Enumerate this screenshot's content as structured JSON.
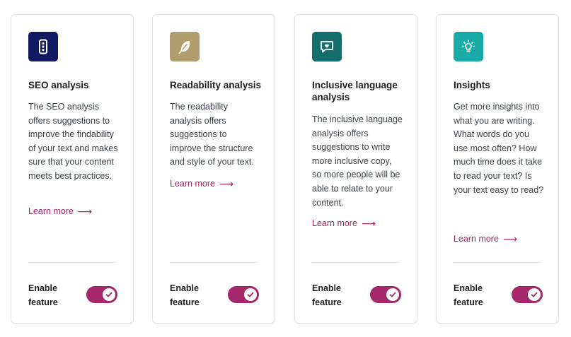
{
  "colors": {
    "accent": "#a4286a",
    "seo_icon_bg": "#101a63",
    "readability_icon_bg": "#af9d6b",
    "inclusive_icon_bg": "#126d6b",
    "insights_icon_bg": "#1aaba9"
  },
  "cards": [
    {
      "icon": "traffic-light-icon",
      "title": "SEO analysis",
      "description": "The SEO analysis offers suggestions to improve the findability of your text and makes sure that your content meets best practices.",
      "learn_more": "Learn more",
      "enable_label": "Enable feature",
      "enabled": true
    },
    {
      "icon": "feather-icon",
      "title": "Readability analysis",
      "description": "The readability analysis offers suggestions to improve the structure and style of your text.",
      "learn_more": "Learn more",
      "enable_label": "Enable feature",
      "enabled": true
    },
    {
      "icon": "chat-heart-icon",
      "title": "Inclusive language analysis",
      "description": "The inclusive language analysis offers suggestions to write more inclusive copy, so more people will be able to relate to your content.",
      "learn_more": "Learn more",
      "enable_label": "Enable feature",
      "enabled": true
    },
    {
      "icon": "lightbulb-icon",
      "title": "Insights",
      "description": "Get more insights into what you are writing. What words do you use most often? How much time does it take to read your text? Is your text easy to read?",
      "learn_more": "Learn more",
      "enable_label": "Enable feature",
      "enabled": true
    }
  ]
}
